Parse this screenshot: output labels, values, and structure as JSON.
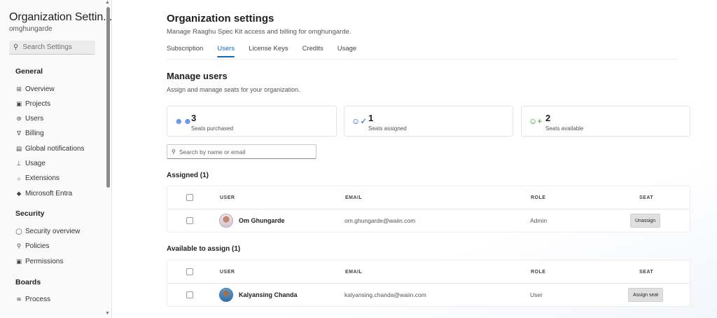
{
  "sidebar": {
    "title": "Organization Settin...",
    "subtitle": "omghungarde",
    "search_placeholder": "Search Settings",
    "sections": [
      {
        "heading": "General",
        "items": [
          {
            "label": "Overview",
            "icon": "grid-icon"
          },
          {
            "label": "Projects",
            "icon": "projects-icon"
          },
          {
            "label": "Users",
            "icon": "users-icon"
          },
          {
            "label": "Billing",
            "icon": "cart-icon"
          },
          {
            "label": "Global notifications",
            "icon": "notification-icon"
          },
          {
            "label": "Usage",
            "icon": "usage-icon"
          },
          {
            "label": "Extensions",
            "icon": "extensions-icon"
          },
          {
            "label": "Microsoft Entra",
            "icon": "entra-icon"
          }
        ]
      },
      {
        "heading": "Security",
        "items": [
          {
            "label": "Security overview",
            "icon": "shield-icon"
          },
          {
            "label": "Policies",
            "icon": "policy-icon"
          },
          {
            "label": "Permissions",
            "icon": "lock-icon"
          }
        ]
      },
      {
        "heading": "Boards",
        "items": [
          {
            "label": "Process",
            "icon": "process-icon"
          }
        ]
      }
    ]
  },
  "header": {
    "title": "Organization settings",
    "subtitle": "Manage Raaghu Spec Kit access and billing for omghungarde."
  },
  "tabs": [
    {
      "label": "Subscription",
      "active": false
    },
    {
      "label": "Users",
      "active": true
    },
    {
      "label": "License Keys",
      "active": false
    },
    {
      "label": "Credits",
      "active": false
    },
    {
      "label": "Usage",
      "active": false
    }
  ],
  "manage": {
    "title": "Manage users",
    "subtitle": "Assign and manage seats for your organization."
  },
  "stats": [
    {
      "value": "3",
      "label": "Seats purchased",
      "icon": "people-group-icon",
      "color": "#5b8def"
    },
    {
      "value": "1",
      "label": "Seats assigned",
      "icon": "person-check-icon",
      "color": "#3b54c7"
    },
    {
      "value": "2",
      "label": "Seats available",
      "icon": "person-add-icon",
      "color": "#2f9e44"
    }
  ],
  "filter_placeholder": "Search by name or email",
  "columns": {
    "user": "USER",
    "email": "EMAIL",
    "role": "ROLE",
    "seat": "SEAT"
  },
  "assigned": {
    "title": "Assigned (1)",
    "rows": [
      {
        "name": "Om Ghungarde",
        "email": "om.ghungarde@waiin.com",
        "role": "Admin",
        "action": "Unassign"
      }
    ]
  },
  "available": {
    "title": "Available to assign (1)",
    "rows": [
      {
        "name": "Kalyansing Chanda",
        "email": "kalyansing.chanda@waiin.com",
        "role": "User",
        "action": "Assign seat"
      }
    ]
  },
  "colors": {
    "accent": "#0f6cbd",
    "sidebar_bg": "#fafafa"
  }
}
